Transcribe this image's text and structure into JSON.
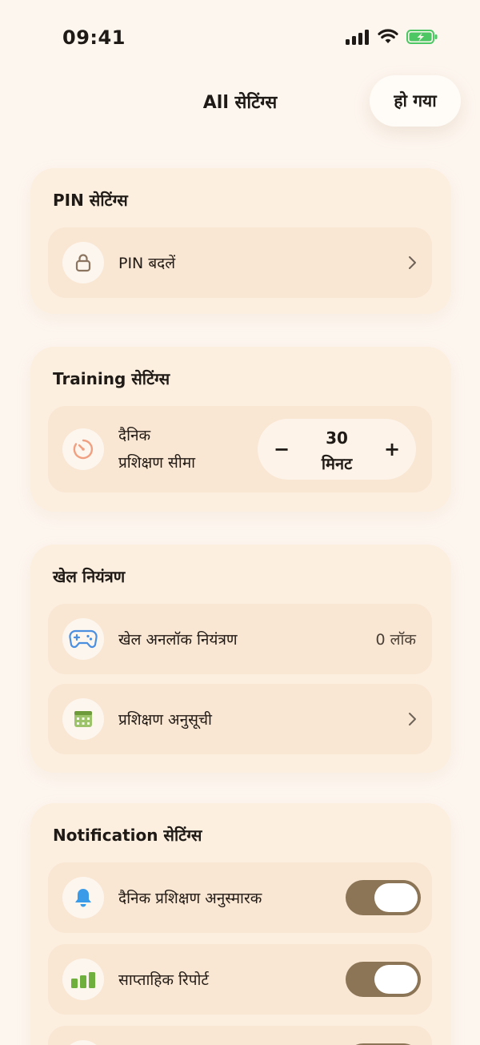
{
  "status_bar": {
    "time": "09:41"
  },
  "header": {
    "title": "All सेटिंग्स",
    "done_label": "हो गया"
  },
  "pin_section": {
    "title": "PIN सेटिंग्स",
    "change_pin_label": "PIN बदलें"
  },
  "training_section": {
    "title": "Training सेटिंग्स",
    "daily_limit_line1": "दैनिक",
    "daily_limit_line2": "प्रशिक्षण सीमा",
    "stepper_value": "30",
    "stepper_unit": "मिनट",
    "minus": "−",
    "plus": "+"
  },
  "game_section": {
    "title": "खेल नियंत्रण",
    "unlock_label": "खेल अनलॉक नियंत्रण",
    "unlock_value": "0 लॉक",
    "schedule_label": "प्रशिक्षण अनुसूची"
  },
  "notification_section": {
    "title": "Notification सेटिंग्स",
    "daily_reminder_label": "दैनिक प्रशिक्षण अनुस्मारक",
    "daily_reminder_on": true,
    "weekly_report_label": "साप्ताहिक रिपोर्ट",
    "weekly_report_on": true
  },
  "colors": {
    "background": "#FDF6EF",
    "card": "#FCEFDF",
    "row": "#F9E6D3",
    "toggle_on": "#8B7556",
    "timer_icon": "#F0A080",
    "gamepad_icon": "#4A8FE0",
    "calendar_icon": "#7FAF4A",
    "bell_icon": "#3A9BE8",
    "chart_icon": "#6FAF3E"
  }
}
